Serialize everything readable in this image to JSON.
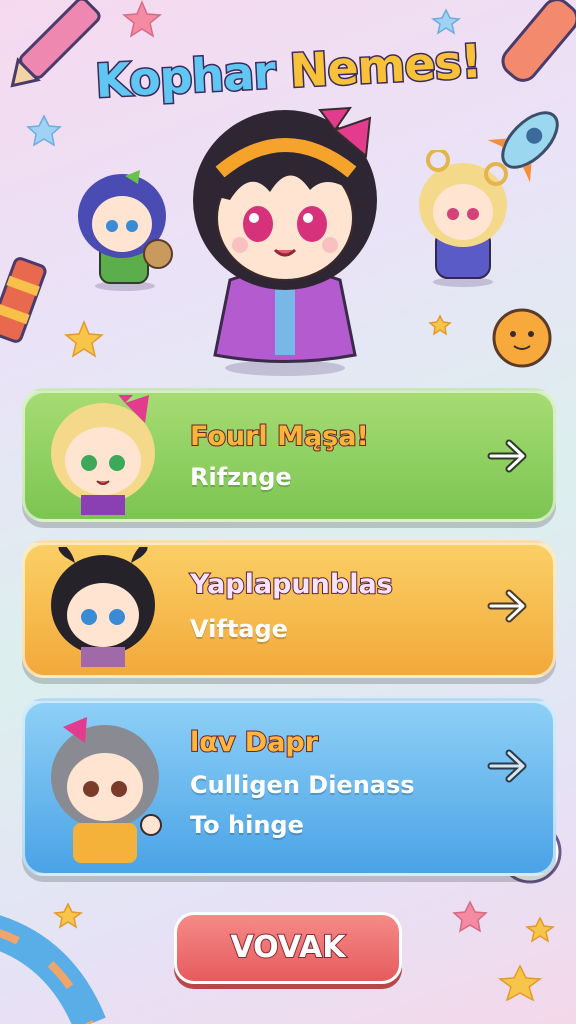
{
  "title": {
    "part1": "Kophar ",
    "part2": "Nemes!"
  },
  "cards": [
    {
      "title": "Fourl Mąşa!",
      "subtitle": "Rifznge",
      "line2": "",
      "color": "#7cc552"
    },
    {
      "title": "Yaplapunblas",
      "subtitle": "Viftage",
      "line2": "",
      "color": "#f2a93a"
    },
    {
      "title": "lαv Dapr",
      "subtitle": "Culligen Dienass",
      "line2": "To hinge",
      "color": "#4aa3e6"
    }
  ],
  "button": {
    "label": "VOVAK"
  },
  "icons": [
    "arrow-right-icon",
    "star-icon",
    "rocket-icon",
    "pencil-icon",
    "sun-icon"
  ]
}
